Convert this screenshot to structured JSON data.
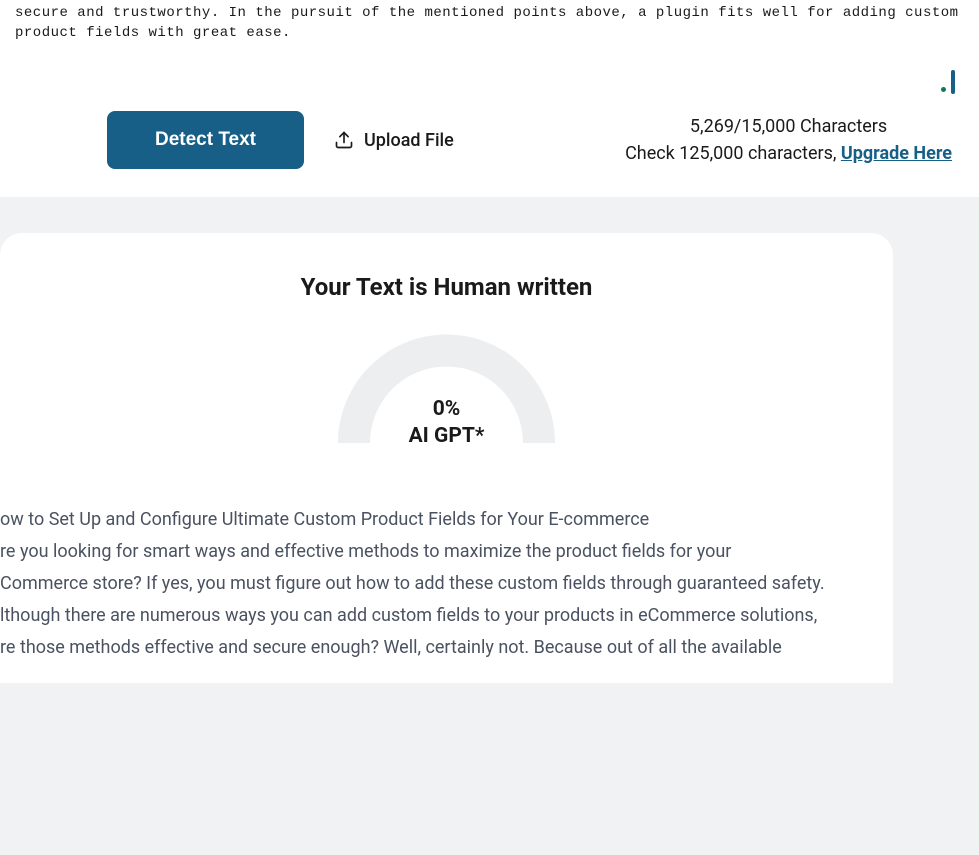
{
  "topText": "secure and trustworthy. In the pursuit of the mentioned points above, a plugin fits well for adding custom product fields with great ease.",
  "toolbar": {
    "detectButton": "Detect Text",
    "uploadFile": "Upload File"
  },
  "charInfo": {
    "counter": "5,269/15,000 Characters",
    "checkPrefix": "Check 125,000 characters, ",
    "upgradeLink": "Upgrade Here"
  },
  "results": {
    "title": "Your Text is Human written",
    "gaugePercent": "0%",
    "gaugeLabel": "AI GPT*"
  },
  "analyzedText": {
    "line1": "ow to Set Up and Configure Ultimate Custom Product Fields for Your E-commerce",
    "line2": "re you looking for smart ways and effective methods to maximize the product fields for your",
    "line3": "Commerce store? If yes, you must figure out how to add these custom fields through guaranteed safety.",
    "line4": "lthough there are numerous ways you can add custom fields to your products in eCommerce solutions,",
    "line5": "re those methods effective and secure enough? Well, certainly not. Because out of all the available"
  }
}
